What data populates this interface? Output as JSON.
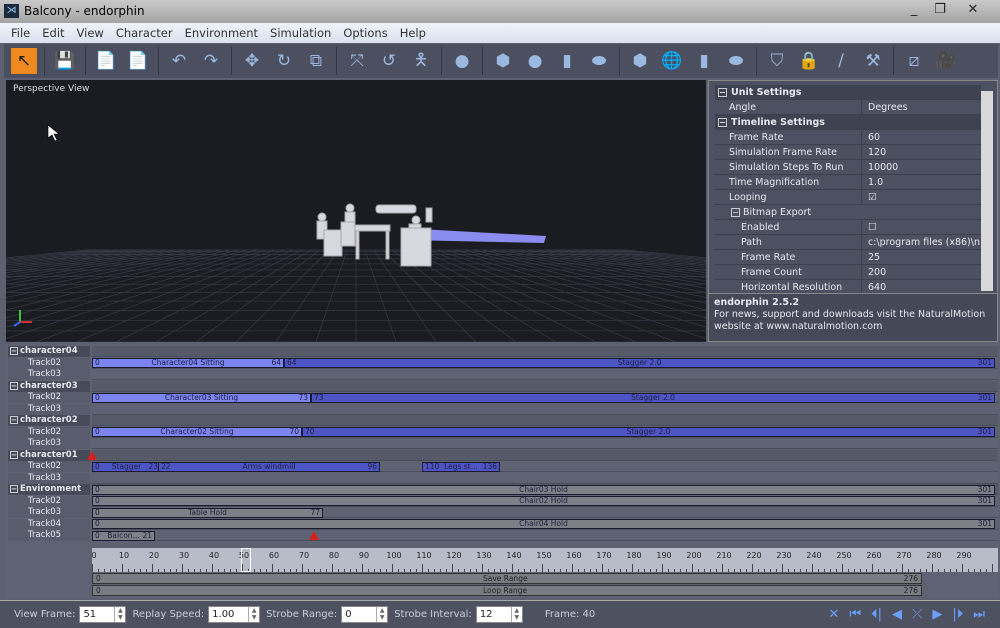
{
  "window": {
    "title": "Balcony - endorphin",
    "controls": [
      "minimize",
      "restore",
      "close"
    ]
  },
  "menu": [
    "File",
    "Edit",
    "View",
    "Character",
    "Environment",
    "Simulation",
    "Options",
    "Help"
  ],
  "toolbar": [
    {
      "icon": "select-arrow-icon",
      "glyph": "↖",
      "active": true
    },
    "sep",
    {
      "icon": "save-icon",
      "glyph": "💾"
    },
    "sep",
    {
      "icon": "import-icon",
      "glyph": "📄"
    },
    {
      "icon": "export-icon",
      "glyph": "📄"
    },
    "sep",
    {
      "icon": "undo-icon",
      "glyph": "↶"
    },
    {
      "icon": "redo-icon",
      "glyph": "↷"
    },
    "sep",
    {
      "icon": "move-icon",
      "glyph": "✥"
    },
    {
      "icon": "rotate-icon",
      "glyph": "↻"
    },
    {
      "icon": "scale-icon",
      "glyph": "⧉"
    },
    "sep",
    {
      "icon": "character-move-icon",
      "glyph": "⤧"
    },
    {
      "icon": "character-rotate-icon",
      "glyph": "↺"
    },
    {
      "icon": "character-icon",
      "glyph": "🯅"
    },
    "sep",
    {
      "icon": "head-icon",
      "glyph": "●"
    },
    "sep",
    {
      "icon": "box-icon",
      "glyph": "⬢"
    },
    {
      "icon": "sphere-icon",
      "glyph": "●"
    },
    {
      "icon": "cylinder-icon",
      "glyph": "▮"
    },
    {
      "icon": "capsule-icon",
      "glyph": "⬬"
    },
    "sep",
    {
      "icon": "box-collision-icon",
      "glyph": "⬢"
    },
    {
      "icon": "sphere-collision-icon",
      "glyph": "🌐"
    },
    {
      "icon": "cylinder-collision-icon",
      "glyph": "▮"
    },
    {
      "icon": "capsule-collision-icon",
      "glyph": "⬬"
    },
    "sep",
    {
      "icon": "mask-icon",
      "glyph": "⛉"
    },
    {
      "icon": "lock-icon",
      "glyph": "🔒"
    },
    {
      "icon": "pen-icon",
      "glyph": "/"
    },
    {
      "icon": "axe-icon",
      "glyph": "⚒"
    },
    "sep",
    {
      "icon": "link-icon",
      "glyph": "⧄"
    },
    {
      "icon": "camera-lock-icon",
      "glyph": "🎥"
    }
  ],
  "viewport": {
    "label": "Perspective View"
  },
  "properties": {
    "rows": [
      {
        "type": "sec",
        "key": "Unit Settings"
      },
      {
        "key": "Angle",
        "value": "Degrees"
      },
      {
        "type": "sec",
        "key": "Timeline Settings"
      },
      {
        "key": "Frame Rate",
        "value": "60"
      },
      {
        "key": "Simulation Frame Rate",
        "value": "120"
      },
      {
        "key": "Simulation Steps To Run",
        "value": "10000"
      },
      {
        "key": "Time Magnification",
        "value": "1.0"
      },
      {
        "key": "Looping",
        "value": "☑"
      },
      {
        "type": "subsec",
        "key": "Bitmap Export"
      },
      {
        "type": "sub",
        "key": "Enabled",
        "value": "☐"
      },
      {
        "type": "sub",
        "key": "Path",
        "value": "c:\\program files (x86)\\n..."
      },
      {
        "type": "sub",
        "key": "Frame Rate",
        "value": "25"
      },
      {
        "type": "sub",
        "key": "Frame Count",
        "value": "200"
      },
      {
        "type": "sub",
        "key": "Horizontal Resolution",
        "value": "640"
      }
    ],
    "info_title": "endorphin 2.5.2",
    "info_text": "For news, support and downloads visit the NaturalMotion website at www.naturalmotion.com"
  },
  "timeline": {
    "rows": [
      {
        "label": "character04",
        "group": true
      },
      {
        "label": "Track02",
        "bars": [
          {
            "s": 0,
            "e": 64,
            "text": "Character04 Sitting",
            "c": "#7c84f0"
          },
          {
            "s": 64,
            "e": 301,
            "text": "Stagger 2.0",
            "c": "#4d55c4"
          }
        ]
      },
      {
        "label": "Track03"
      },
      {
        "label": "character03",
        "group": true
      },
      {
        "label": "Track02",
        "bars": [
          {
            "s": 0,
            "e": 73,
            "text": "Character03 Sitting",
            "c": "#7c84f0"
          },
          {
            "s": 73,
            "e": 301,
            "text": "Stagger 2.0",
            "c": "#4d55c4"
          }
        ]
      },
      {
        "label": "Track03"
      },
      {
        "label": "character02",
        "group": true
      },
      {
        "label": "Track02",
        "bars": [
          {
            "s": 0,
            "e": 70,
            "text": "Character02 Sitting",
            "c": "#7c84f0"
          },
          {
            "s": 70,
            "e": 301,
            "text": "Stagger 2.0",
            "c": "#4d55c4"
          }
        ]
      },
      {
        "label": "Track03"
      },
      {
        "label": "character01",
        "group": true,
        "marker": 0
      },
      {
        "label": "Track02",
        "bars": [
          {
            "s": 0,
            "e": 23,
            "text": "Stagger",
            "c": "#4d55c4"
          },
          {
            "s": 22,
            "e": 96,
            "text": "Arms windmill",
            "c": "#4d55c4"
          },
          {
            "s": 110,
            "e": 136,
            "text": "Legs st...",
            "c": "#4d55c4"
          }
        ]
      },
      {
        "label": "Track03"
      },
      {
        "label": "Environment",
        "group": true,
        "bars": [
          {
            "s": 0,
            "e": 301,
            "text": "Chair03 Hold",
            "c": "#7e8088"
          }
        ]
      },
      {
        "label": "Track02",
        "bars": [
          {
            "s": 0,
            "e": 301,
            "text": "Chair02 Hold",
            "c": "#7e8088"
          }
        ]
      },
      {
        "label": "Track03",
        "bars": [
          {
            "s": 0,
            "e": 77,
            "text": "Table Hold",
            "c": "#7e8088"
          }
        ]
      },
      {
        "label": "Track04",
        "bars": [
          {
            "s": 0,
            "e": 301,
            "text": "Chair04 Hold",
            "c": "#7e8088"
          }
        ]
      },
      {
        "label": "Track05",
        "bars": [
          {
            "s": 0,
            "e": 21,
            "text": "Balcon...",
            "c": "#7e8088"
          }
        ],
        "marker": 74
      }
    ],
    "ruler_ticks": [
      0,
      10,
      20,
      30,
      40,
      50,
      60,
      70,
      80,
      90,
      100,
      110,
      120,
      130,
      140,
      150,
      160,
      170,
      180,
      190,
      200,
      210,
      220,
      230,
      240,
      250,
      260,
      270,
      280,
      290
    ],
    "current_frame": 51,
    "save_range": {
      "label": "Save Range",
      "start": "0",
      "end": "276"
    },
    "loop_range": {
      "label": "Loop Range",
      "start": "0",
      "end": "276"
    }
  },
  "bottom": {
    "view_frame_label": "View Frame:",
    "view_frame": "51",
    "replay_speed_label": "Replay Speed:",
    "replay_speed": "1.00",
    "strobe_range_label": "Strobe Range:",
    "strobe_range": "0",
    "strobe_interval_label": "Strobe Interval:",
    "strobe_interval": "12",
    "frame_text": "Frame: 40",
    "playback": [
      {
        "icon": "cut-icon",
        "g": "✕"
      },
      {
        "icon": "skip-start-icon",
        "g": "⏮"
      },
      {
        "icon": "step-back-icon",
        "g": "⏴|"
      },
      {
        "icon": "play-back-icon",
        "g": "◀"
      },
      {
        "icon": "loop-icon",
        "g": "⤫"
      },
      {
        "icon": "play-icon",
        "g": "▶"
      },
      {
        "icon": "step-forward-icon",
        "g": "|⏵"
      },
      {
        "icon": "skip-end-icon",
        "g": "⏭"
      }
    ]
  }
}
